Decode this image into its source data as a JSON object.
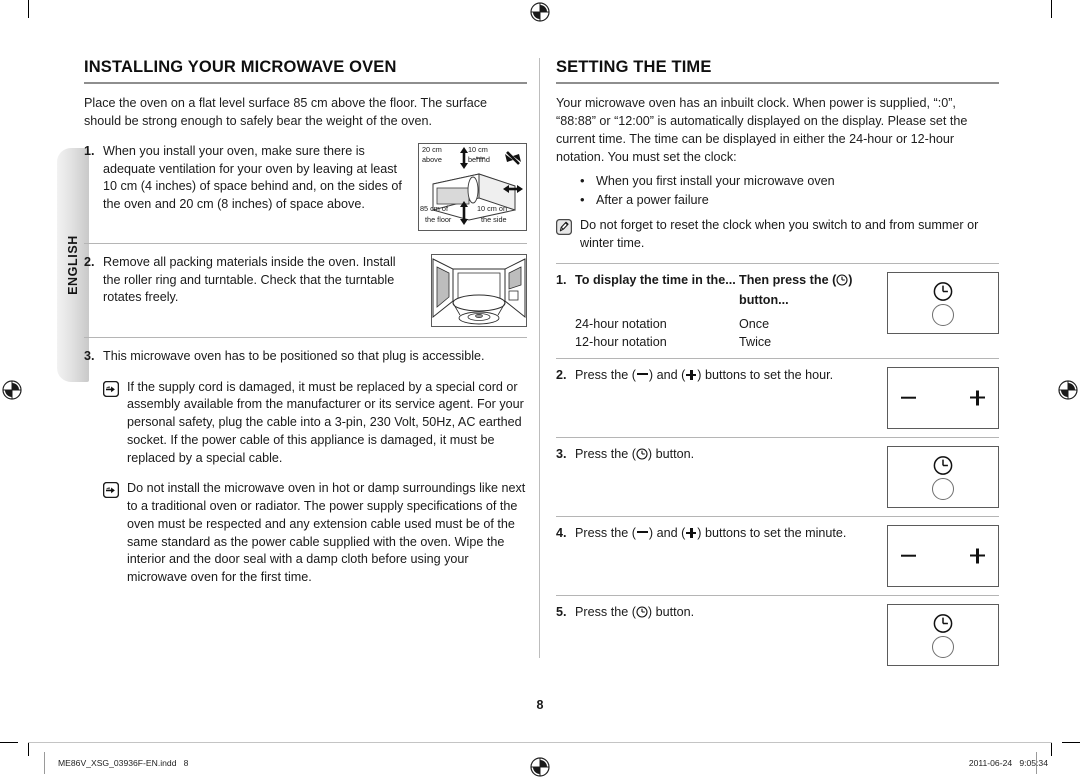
{
  "document": {
    "page_number": "8",
    "language_tab": "ENGLISH"
  },
  "left_column": {
    "title": "INSTALLING YOUR MICROWAVE OVEN",
    "intro": "Place the oven on a flat level surface 85 cm above the floor. The surface should be strong enough to safely bear the weight of the oven.",
    "steps": [
      {
        "num": "1.",
        "text": "When you install your oven, make sure there is adequate ventilation for your oven by leaving at least 10 cm (4 inches) of space behind and, on the sides of the oven and 20 cm (8 inches) of space above.",
        "figure": {
          "name": "oven-clearance-diagram",
          "labels": {
            "top_left": "20 cm",
            "top_left_2": "above",
            "top_right": "10 cm",
            "top_right_2": "behind",
            "bottom_left": "85 cm of",
            "bottom_left_2": "the floor",
            "bottom_right": "10 cm on",
            "bottom_right_2": "the side"
          }
        }
      },
      {
        "num": "2.",
        "text": "Remove all packing materials inside the oven. Install the roller ring and turntable. Check that the turntable rotates freely.",
        "figure": {
          "name": "oven-interior-diagram"
        }
      },
      {
        "num": "3.",
        "text": "This microwave oven has to be positioned so that plug is accessible."
      }
    ],
    "notes": [
      {
        "icon": "pointing-hand-icon",
        "text": "If the supply cord is damaged, it must be replaced by a special cord or assembly available from the manufacturer or its service agent. For your personal safety, plug the cable into a 3-pin, 230 Volt, 50Hz, AC earthed socket. If the power cable of this appliance is damaged, it must be replaced by a special cable."
      },
      {
        "icon": "pointing-hand-icon",
        "text": "Do not install the microwave oven in hot or damp surroundings like next to a traditional oven or radiator. The power supply specifications of the oven must be respected and any extension cable used must be of the same standard as the power cable supplied with the oven. Wipe the interior and the door seal with a damp cloth before using your microwave oven for the first time."
      }
    ]
  },
  "right_column": {
    "title": "SETTING THE TIME",
    "intro": "Your microwave oven has an inbuilt clock. When power is supplied, “:0”, “88:88” or “12:00” is automatically displayed on the display. Please set the current time. The time can be displayed in either the 24-hour or 12-hour notation. You must set the clock:",
    "bullets": [
      "When you first install your microwave oven",
      "After a power failure"
    ],
    "note": {
      "icon": "note-pencil-icon",
      "text": "Do not forget to reset the clock when you switch to and from summer or winter time."
    },
    "steps": [
      {
        "num": "1.",
        "header_col1": "To display the time in the...",
        "header_col2_prefix": "Then press the (",
        "header_col2_suffix": ") button...",
        "rows": [
          {
            "col1": "24-hour notation",
            "col2": "Once"
          },
          {
            "col1": "12-hour notation",
            "col2": "Twice"
          }
        ],
        "panel": "clock-button-panel"
      },
      {
        "num": "2.",
        "text_parts": [
          "Press the (",
          ") and (",
          ") buttons to set the hour."
        ],
        "panel": "minus-plus-panel"
      },
      {
        "num": "3.",
        "text_parts": [
          "Press the (",
          ") button."
        ],
        "panel": "clock-button-panel"
      },
      {
        "num": "4.",
        "text_parts": [
          "Press the (",
          ") and (",
          ") buttons to set the minute."
        ],
        "panel": "minus-plus-panel"
      },
      {
        "num": "5.",
        "text_parts": [
          "Press the (",
          ") button."
        ],
        "panel": "clock-button-panel"
      }
    ]
  },
  "footer": {
    "file_name": "ME86V_XSG_03936F-EN.indd   8",
    "date": "2011-06-24",
    "time": "9:05:34"
  },
  "colors": {
    "rule": "#b5b5b5",
    "title_rule": "#8e8e8e",
    "tab_gray": "#d5d5d5",
    "text": "#1a1a1a"
  }
}
